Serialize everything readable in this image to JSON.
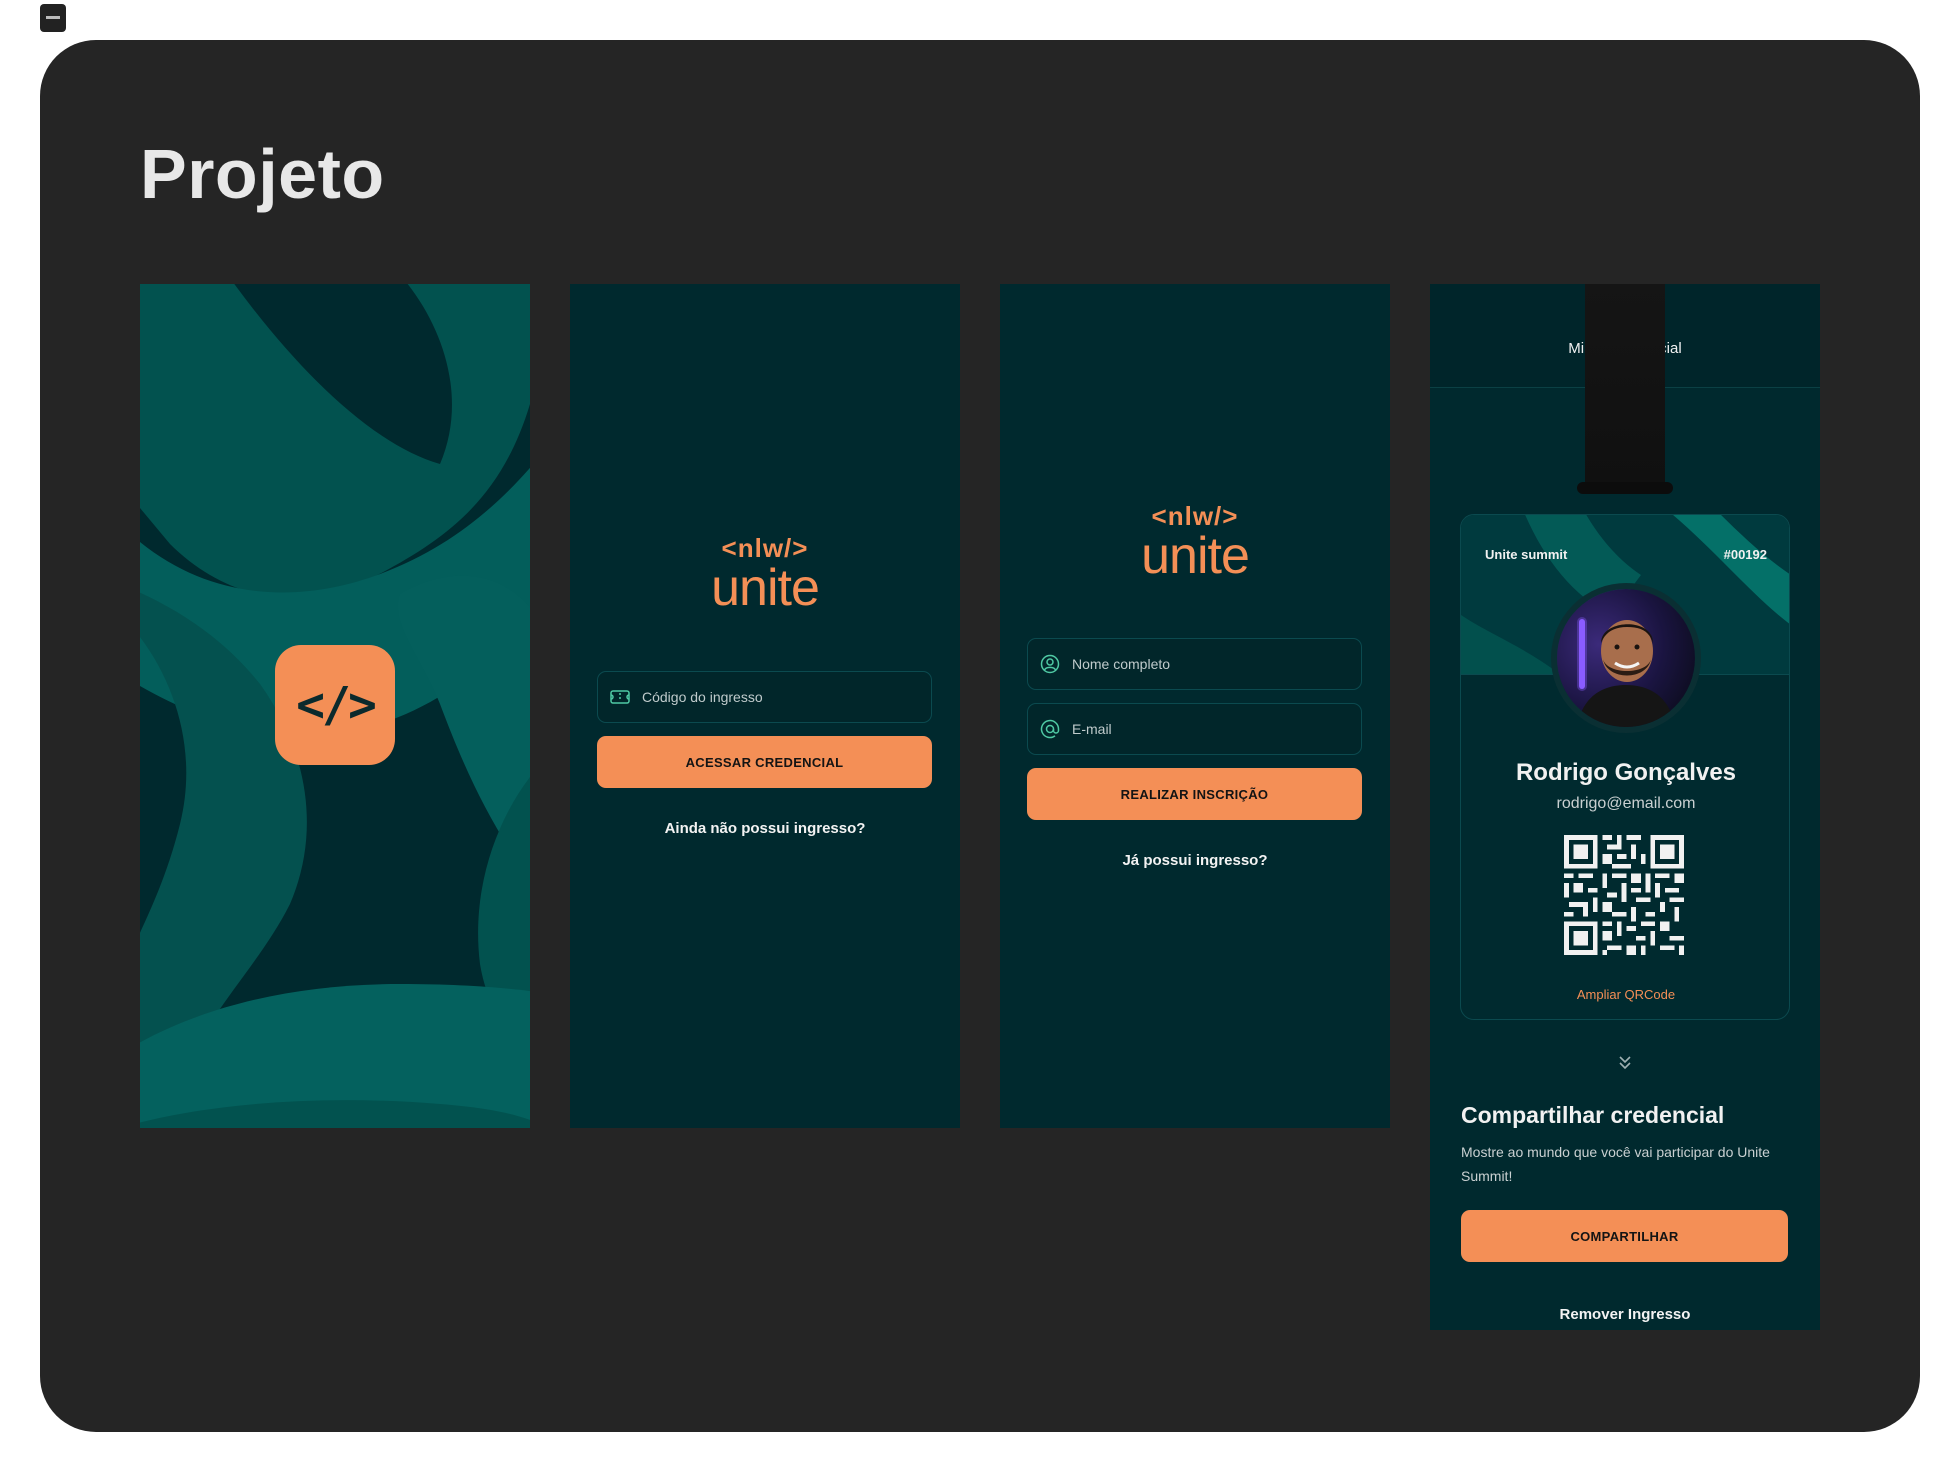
{
  "page": {
    "title": "Projeto"
  },
  "colors": {
    "board": "#252525",
    "screen_bg": "#00292e",
    "accent": "#f48f56",
    "teal_shape": "#02605f"
  },
  "splash": {
    "icon_text": "</>"
  },
  "logo": {
    "tag": "<nlw/>",
    "word": "unite"
  },
  "login": {
    "ticket_placeholder": "Código do ingresso",
    "button": "ACESSAR CREDENCIAL",
    "link": "Ainda não possui ingresso?"
  },
  "register": {
    "name_placeholder": "Nome completo",
    "email_placeholder": "E-mail",
    "button": "REALIZAR INSCRIÇÃO",
    "link": "Já possui ingresso?"
  },
  "credential": {
    "header_title": "Minha credencial",
    "event": "Unite summit",
    "number": "#00192",
    "name": "Rodrigo Gonçalves",
    "email": "rodrigo@email.com",
    "qr_link": "Ampliar QRCode",
    "share_title": "Compartilhar credencial",
    "share_desc": "Mostre ao mundo que você vai participar do Unite Summit!",
    "share_button": "COMPARTILHAR",
    "remove_link": "Remover Ingresso"
  }
}
